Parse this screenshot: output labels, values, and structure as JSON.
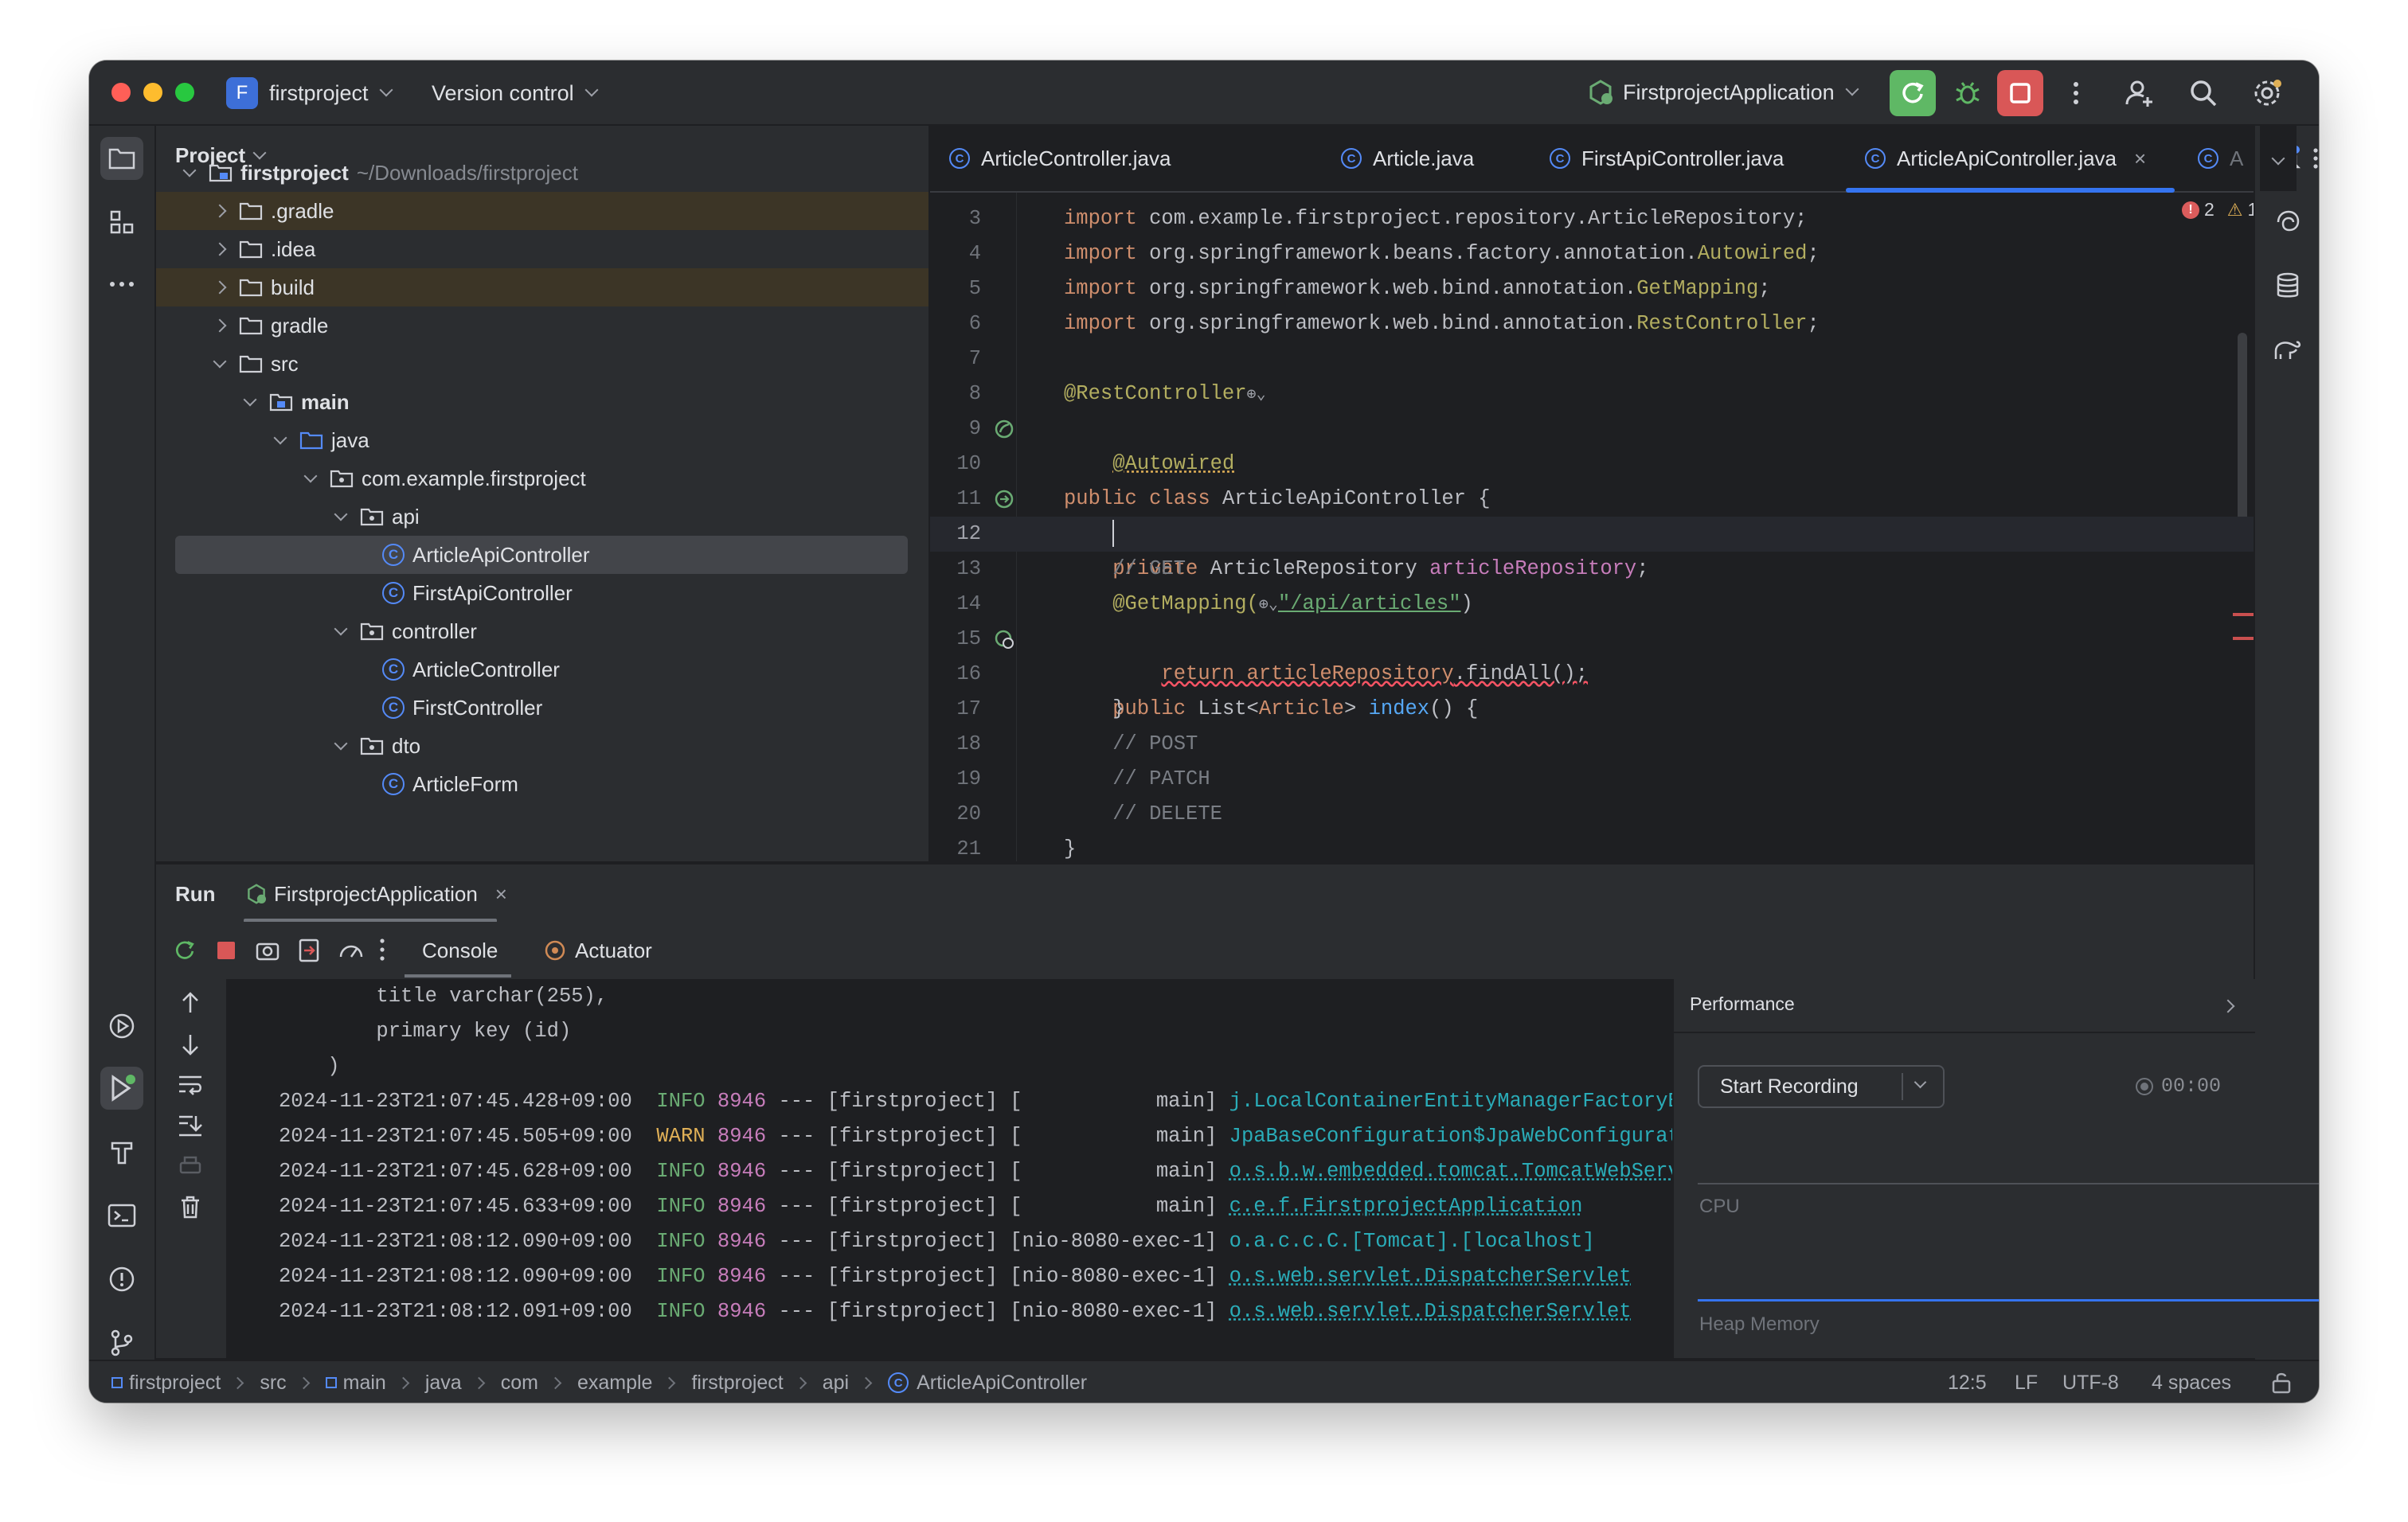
{
  "titlebar": {
    "project_badge": "F",
    "project_name": "firstproject",
    "version_control": "Version control",
    "run_config": "FirstprojectApplication",
    "icons": [
      "rerun-icon",
      "debug-icon",
      "stop-icon",
      "more-icon",
      "add-user-icon",
      "search-icon",
      "settings-icon"
    ]
  },
  "project_panel": {
    "title": "Project",
    "tree": [
      {
        "label": "firstproject",
        "hint": "~/Downloads/firstproject",
        "type": "module",
        "state": "open"
      },
      {
        "label": ".gradle",
        "type": "folder",
        "state": "closed"
      },
      {
        "label": ".idea",
        "type": "folder",
        "state": "closed"
      },
      {
        "label": "build",
        "type": "folder",
        "state": "closed"
      },
      {
        "label": "gradle",
        "type": "folder",
        "state": "closed"
      },
      {
        "label": "src",
        "type": "folder",
        "state": "open"
      },
      {
        "label": "main",
        "type": "source-folder",
        "state": "open"
      },
      {
        "label": "java",
        "type": "java-folder",
        "state": "open"
      },
      {
        "label": "com.example.firstproject",
        "type": "package",
        "state": "open"
      },
      {
        "label": "api",
        "type": "package",
        "state": "open"
      },
      {
        "label": "ArticleApiController",
        "type": "class",
        "selected": true
      },
      {
        "label": "FirstApiController",
        "type": "class"
      },
      {
        "label": "controller",
        "type": "package",
        "state": "open"
      },
      {
        "label": "ArticleController",
        "type": "class"
      },
      {
        "label": "FirstController",
        "type": "class"
      },
      {
        "label": "dto",
        "type": "package",
        "state": "open"
      },
      {
        "label": "ArticleForm",
        "type": "class"
      }
    ]
  },
  "editor": {
    "tabs": [
      {
        "label": "ArticleController.java"
      },
      {
        "label": "Article.java"
      },
      {
        "label": "FirstApiController.java"
      },
      {
        "label": "ArticleApiController.java",
        "active": true
      },
      {
        "label": "A"
      }
    ],
    "inspections": {
      "errors": "2",
      "warnings": "1"
    },
    "lines": [
      {
        "num": "3"
      },
      {
        "num": "4"
      },
      {
        "num": "5"
      },
      {
        "num": "6"
      },
      {
        "num": "7"
      },
      {
        "num": "8"
      },
      {
        "num": "9"
      },
      {
        "num": "10"
      },
      {
        "num": "11"
      },
      {
        "num": "12"
      },
      {
        "num": "13"
      },
      {
        "num": "14"
      },
      {
        "num": "15"
      },
      {
        "num": "16"
      },
      {
        "num": "17"
      },
      {
        "num": "18"
      },
      {
        "num": "19"
      },
      {
        "num": "20"
      },
      {
        "num": "21"
      }
    ],
    "code": {
      "l3a": "import ",
      "l3b": "com.example.firstproject.repository.ArticleRepository;",
      "l4a": "import ",
      "l4b": "org.springframework.beans.factory.annotation.",
      "l4c": "Autowired",
      "l4d": ";",
      "l5a": "import ",
      "l5b": "org.springframework.web.bind.annotation.",
      "l5c": "GetMapping",
      "l5d": ";",
      "l6a": "import ",
      "l6b": "org.springframework.web.bind.annotation.",
      "l6c": "RestController",
      "l6d": ";",
      "l8a": "@RestController",
      "l9a": "public class ",
      "l9b": "ArticleApiController {",
      "l10a": "@Autowired",
      "l11a": "private ",
      "l11b": "ArticleRepository ",
      "l11c": "articleRepository",
      "l11d": ";",
      "l13a": "// GET",
      "l14a": "@GetMapping(",
      "l14b": "\"/api/articles\"",
      "l14c": ")",
      "l15a": "public ",
      "l15b": "List<",
      "l15c": "Article",
      "l15d": "> ",
      "l15e": "index",
      "l15f": "() {",
      "l16a": "return articleRepository",
      "l16b": ".findAll();",
      "l17a": "}",
      "l18a": "// POST",
      "l19a": "// PATCH",
      "l20a": "// DELETE",
      "l21a": "}"
    }
  },
  "run_panel": {
    "title": "Run",
    "tab": "FirstprojectApplication",
    "console_tab": "Console",
    "actuator_tab": "Actuator",
    "console_lines": [
      {
        "text": "        title varchar(255),"
      },
      {
        "text": "        primary key (id)"
      },
      {
        "text": "    )"
      }
    ],
    "log_rows": [
      {
        "ts": "2024-11-23T21:07:45.428+09:00",
        "level": "INFO",
        "pid": "8946",
        "mid": " --- [firstproject] [           main] ",
        "logger": "j.LocalContainerEntityManagerFactoryBean"
      },
      {
        "ts": "2024-11-23T21:07:45.505+09:00",
        "level": "WARN",
        "pid": "8946",
        "mid": " --- [firstproject] [           main] ",
        "logger": "JpaBaseConfiguration$JpaWebConfiguration"
      },
      {
        "ts": "2024-11-23T21:07:45.628+09:00",
        "level": "INFO",
        "pid": "8946",
        "mid": " --- [firstproject] [           main] ",
        "logger": "o.s.b.w.embedded.tomcat.TomcatWebServer"
      },
      {
        "ts": "2024-11-23T21:07:45.633+09:00",
        "level": "INFO",
        "pid": "8946",
        "mid": " --- [firstproject] [           main] ",
        "logger": "c.e.f.FirstprojectApplication"
      },
      {
        "ts": "2024-11-23T21:08:12.090+09:00",
        "level": "INFO",
        "pid": "8946",
        "mid": " --- [firstproject] [nio-8080-exec-1] ",
        "logger": "o.a.c.c.C.[Tomcat].[localhost]"
      },
      {
        "ts": "2024-11-23T21:08:12.090+09:00",
        "level": "INFO",
        "pid": "8946",
        "mid": " --- [firstproject] [nio-8080-exec-1] ",
        "logger": "o.s.web.servlet.DispatcherServlet"
      },
      {
        "ts": "2024-11-23T21:08:12.091+09:00",
        "level": "INFO",
        "pid": "8946",
        "mid": " --- [firstproject] [nio-8080-exec-1] ",
        "logger": "o.s.web.servlet.DispatcherServlet"
      }
    ],
    "performance": {
      "title": "Performance",
      "start_recording": "Start Recording",
      "timer": "00:00",
      "cpu_label": "CPU",
      "heap_label": "Heap Memory"
    }
  },
  "statusbar": {
    "breadcrumbs": [
      "firstproject",
      "src",
      "main",
      "java",
      "com",
      "example",
      "firstproject",
      "api",
      "ArticleApiController"
    ],
    "position": "12:5",
    "line_sep": "LF",
    "encoding": "UTF-8",
    "indent": "4 spaces"
  },
  "colors": {
    "accent": "#3574f0",
    "run_green": "#5fb865",
    "stop_red": "#d95757",
    "error_red": "#f75464",
    "warning_yellow": "#e0b057"
  }
}
